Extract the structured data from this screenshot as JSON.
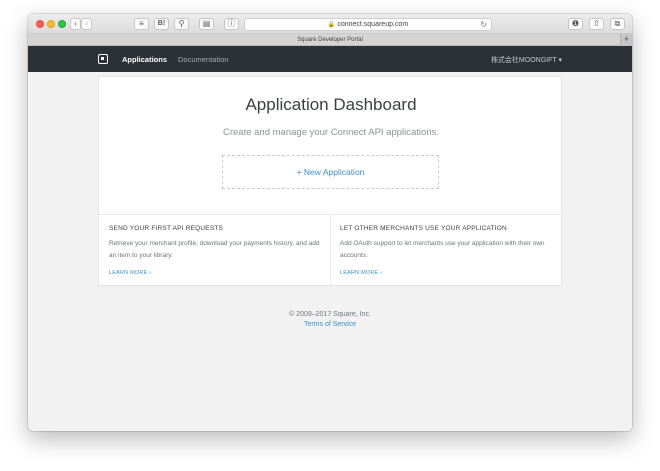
{
  "browser": {
    "url": "connect.squareup.com",
    "tab_title": "Square Developer Portal",
    "icons": {
      "back": "‹",
      "forward": "›",
      "ext_stack": "≡",
      "ext_b": "B!",
      "ext_link": "⚲",
      "ext_reader": "▤",
      "ext_info": "ⓘ",
      "ext_shield": "❶",
      "share": "⇧",
      "tabs": "⧉",
      "reload": "↻",
      "lock": "🔒",
      "new_tab": "+"
    }
  },
  "nav": {
    "applications": "Applications",
    "documentation": "Documentation",
    "account": "株式会社MOONGIFT ▾"
  },
  "dashboard": {
    "title": "Application Dashboard",
    "subtitle": "Create and manage your Connect API applications.",
    "new_app": "+ New Application"
  },
  "info_left": {
    "heading": "SEND YOUR FIRST API REQUESTS",
    "text": "Retrieve your merchant profile, download your payments history, and add an item to your library.",
    "link": "LEARN MORE ›"
  },
  "info_right": {
    "heading": "LET OTHER MERCHANTS USE YOUR APPLICATION",
    "text": "Add OAuth support to let merchants use your application with their own accounts.",
    "link": "LEARN MORE ›"
  },
  "footer": {
    "copyright": "© 2009–2017 Square, Inc.",
    "tos": "Terms of Service"
  },
  "colors": {
    "navbar": "#2b3137",
    "link": "#3d8fd1",
    "page_bg": "#f1f2f1"
  }
}
